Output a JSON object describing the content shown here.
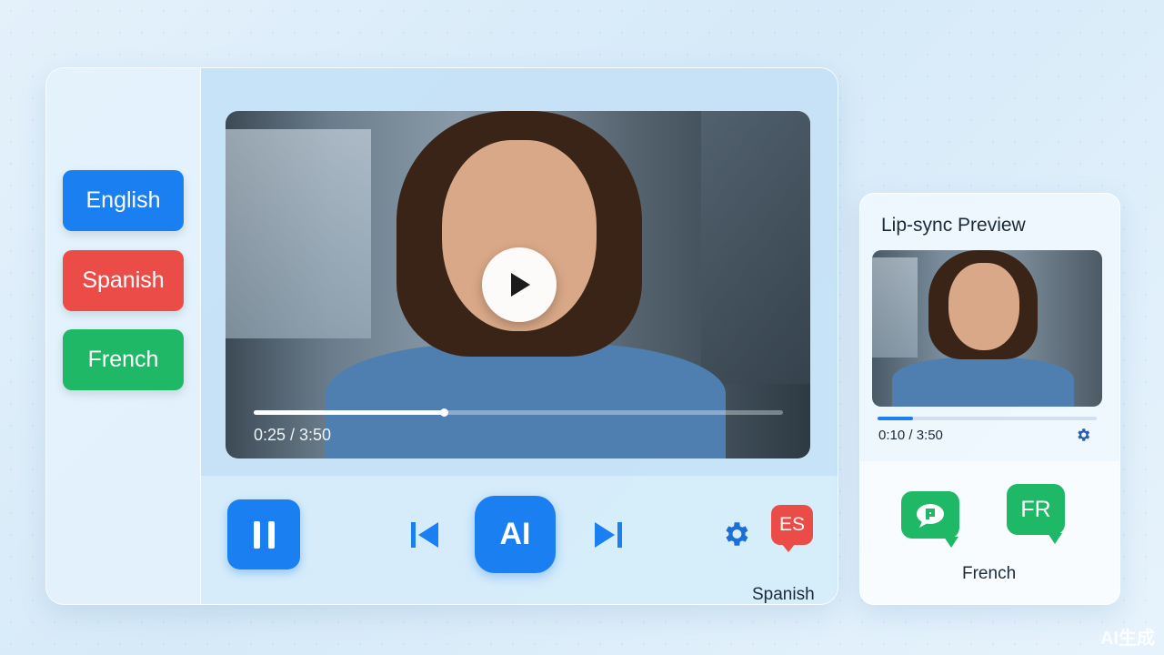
{
  "languages": [
    {
      "label": "English",
      "color": "#1a7ff0"
    },
    {
      "label": "Spanish",
      "color": "#ec4c48"
    },
    {
      "label": "French",
      "color": "#1fb866"
    }
  ],
  "player": {
    "time_display": "0:25 / 3:50",
    "progress": 0.36,
    "play_icon": "play-icon"
  },
  "controls": {
    "pause_icon": "pause-icon",
    "prev_icon": "skip-back-icon",
    "ai_label": "AI",
    "next_icon": "skip-forward-icon",
    "settings_icon": "gear-icon",
    "language_badge": "ES",
    "language_caption": "Spanish"
  },
  "preview": {
    "title": "Lip-sync Preview",
    "time_display": "0:10 / 3:50",
    "progress": 0.16,
    "settings_icon": "gear-icon",
    "chat_icon": "chat-bubble-icon",
    "language_badge": "FR",
    "language_caption": "French"
  },
  "watermark": {
    "text": "AI生成"
  },
  "colors": {
    "accent_blue": "#1a7ff0",
    "spanish_red": "#ec4c48",
    "french_green": "#1fb866"
  }
}
